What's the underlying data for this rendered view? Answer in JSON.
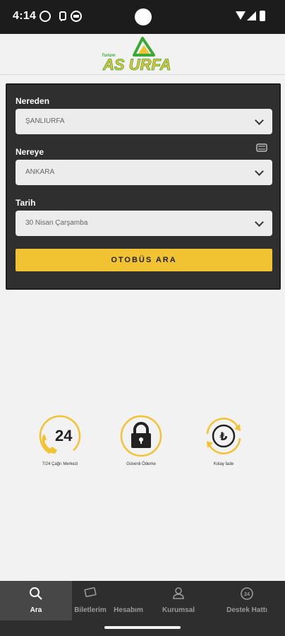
{
  "status_bar": {
    "time": "4:14"
  },
  "header": {
    "logo_text": "AS URFA",
    "logo_small_text": "Turizm"
  },
  "search": {
    "from_label": "Nereden",
    "from_value": "ŞANLIURFA",
    "to_label": "Nereye",
    "to_value": "ANKARA",
    "date_label": "Tarih",
    "date_value": "30 Nisan Çarşamba",
    "button_label": "OTOBÜS ARA"
  },
  "features": [
    {
      "label": "7/24 Çağrı Merkezi",
      "number": "24",
      "icon": "call-center-24-icon"
    },
    {
      "label": "Güvenli Ödeme",
      "icon": "padlock-icon"
    },
    {
      "label": "Kolay İade",
      "icon": "lira-refund-icon"
    }
  ],
  "nav": [
    {
      "label": "Ara",
      "icon": "search-icon",
      "active": true
    },
    {
      "label": "Biletlerim",
      "icon": "ticket-icon"
    },
    {
      "label": "Hesabım",
      "icon": "account-icon"
    },
    {
      "label": "Kurumsal",
      "icon": "user-icon"
    },
    {
      "label": "Destek Hattı",
      "icon": "support-icon"
    }
  ],
  "colors": {
    "accent": "#f1c232",
    "card": "#2f2f2f",
    "nav": "#2e2e2e",
    "logo_green": "#3aa935"
  }
}
